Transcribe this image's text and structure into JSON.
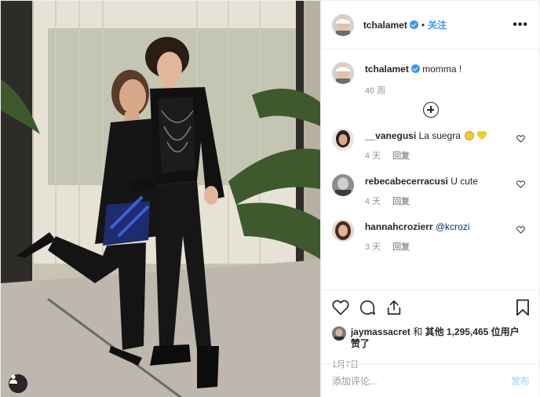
{
  "post": {
    "author": "tchalamet",
    "follow_separator": "•",
    "follow_label": "关注",
    "more_label": "•••"
  },
  "caption": {
    "username": "tchalamet",
    "text": "momma !",
    "time": "46 周"
  },
  "comments": [
    {
      "username": "__vanegusi",
      "text": "La suegra",
      "time": "4 天",
      "reply": "回复",
      "emojis": [
        "slightly-smiling-face",
        "yellow-heart"
      ]
    },
    {
      "username": "rebecabecerracusi",
      "text": "U cute",
      "time": "4 天",
      "reply": "回复"
    },
    {
      "username": "hannahcrozierr",
      "text": "@kcrozi",
      "time": "3 天",
      "reply": "回复"
    }
  ],
  "likes": {
    "first_user": "jaymassacret",
    "connector": "和",
    "others_label": "其他 1,295,465 位用户",
    "suffix": "赞了"
  },
  "date": "1月7日",
  "add_comment": {
    "placeholder": "添加评论...",
    "post_label": "发布"
  },
  "colors": {
    "link_blue": "#3897f0",
    "muted": "#999999",
    "post_disabled": "#b2dffc"
  }
}
